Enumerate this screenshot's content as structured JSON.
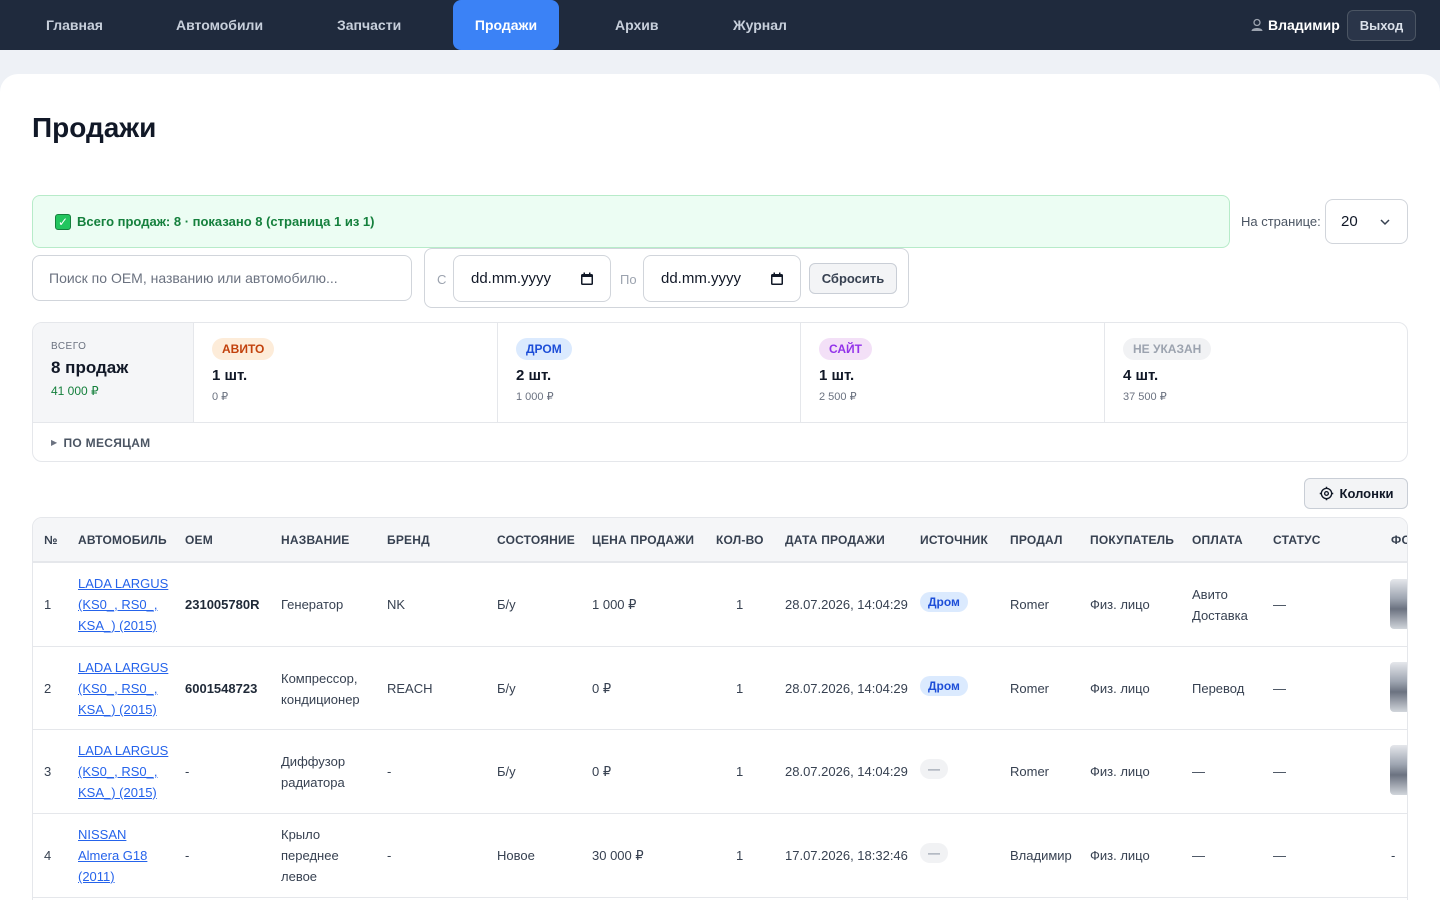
{
  "nav": {
    "items": [
      {
        "label": "Главная"
      },
      {
        "label": "Автомобили"
      },
      {
        "label": "Запчасти"
      },
      {
        "label": "Продажи",
        "active": true
      },
      {
        "label": "Архив"
      },
      {
        "label": "Журнал"
      }
    ],
    "user": "Владимир",
    "logout": "Выход"
  },
  "page": {
    "title": "Продажи"
  },
  "summary": {
    "text": "Всего продаж: 8 · показано 8 (страница 1 из 1)"
  },
  "perpage": {
    "label": "На странице:",
    "value": "20"
  },
  "filters": {
    "search_placeholder": "Поиск по OEM, названию или автомобилю...",
    "from_label": "С",
    "to_label": "По",
    "from_value": "dd.mm.yyyy",
    "to_value": "dd.mm.yyyy",
    "reset": "Сбросить"
  },
  "stats": {
    "total_label": "ВСЕГО",
    "total_count": "8 продаж",
    "total_sum": "41 000 ₽",
    "sources": [
      {
        "name": "АВИТО",
        "count": "1 шт.",
        "sum": "0 ₽",
        "bg": "#fdecd9",
        "fg": "#c2410c"
      },
      {
        "name": "ДРОМ",
        "count": "2 шт.",
        "sum": "1 000 ₽",
        "bg": "#dbeafe",
        "fg": "#1d4ed8"
      },
      {
        "name": "САЙТ",
        "count": "1 шт.",
        "sum": "2 500 ₽",
        "bg": "#f3e0f7",
        "fg": "#9333ea"
      },
      {
        "name": "НЕ УКАЗАН",
        "count": "4 шт.",
        "sum": "37 500 ₽",
        "bg": "#f1f2f4",
        "fg": "#9ca3af"
      }
    ],
    "months": "ПО МЕСЯЦАМ"
  },
  "columns_button": "Колонки",
  "table": {
    "headers": [
      "№",
      "АВТОМОБИЛЬ",
      "OEM",
      "НАЗВАНИЕ",
      "БРЕНД",
      "СОСТОЯНИЕ",
      "ЦЕНА ПРОДАЖИ",
      "КОЛ-ВО",
      "ДАТА ПРОДАЖИ",
      "ИСТОЧНИК",
      "ПРОДАЛ",
      "ПОКУПАТЕЛЬ",
      "ОПЛАТА",
      "СТАТУС",
      "ФО"
    ],
    "rows": [
      {
        "n": "1",
        "car": [
          "LADA LARGUS",
          "(KS0_, RS0_,",
          "KSA_) (2015)"
        ],
        "oem": "231005780R",
        "name": [
          "Генератор"
        ],
        "brand": "NK",
        "cond": "Б/у",
        "price": "1 000 ₽",
        "qty": "1",
        "date": "28.07.2026, 14:04:29",
        "source": "Дром",
        "seller": "Romer",
        "buyer": "Физ. лицо",
        "payment": [
          "Авито",
          "Доставка"
        ],
        "status": "—",
        "photo": true
      },
      {
        "n": "2",
        "car": [
          "LADA LARGUS",
          "(KS0_, RS0_,",
          "KSA_) (2015)"
        ],
        "oem": "6001548723",
        "name": [
          "Компрессор,",
          "кондиционер"
        ],
        "brand": "REACH",
        "cond": "Б/у",
        "price": "0 ₽",
        "qty": "1",
        "date": "28.07.2026, 14:04:29",
        "source": "Дром",
        "seller": "Romer",
        "buyer": "Физ. лицо",
        "payment": [
          "Перевод"
        ],
        "status": "—",
        "photo": true
      },
      {
        "n": "3",
        "car": [
          "LADA LARGUS",
          "(KS0_, RS0_,",
          "KSA_) (2015)"
        ],
        "oem": "-",
        "name": [
          "Диффузор",
          "радиатора"
        ],
        "brand": "-",
        "cond": "Б/у",
        "price": "0 ₽",
        "qty": "1",
        "date": "28.07.2026, 14:04:29",
        "source": "—",
        "seller": "Romer",
        "buyer": "Физ. лицо",
        "payment": [
          "—"
        ],
        "status": "—",
        "photo": true
      },
      {
        "n": "4",
        "car": [
          "NISSAN",
          "Almera G18",
          "(2011)"
        ],
        "oem": "-",
        "name": [
          "Крыло",
          "переднее",
          "левое"
        ],
        "brand": "-",
        "cond": "Новое",
        "price": "30 000 ₽",
        "qty": "1",
        "date": "17.07.2026, 18:32:46",
        "source": "—",
        "seller": "Владимир",
        "buyer": "Физ. лицо",
        "payment": [
          "—"
        ],
        "status": "—",
        "photo_text": "-"
      }
    ]
  }
}
